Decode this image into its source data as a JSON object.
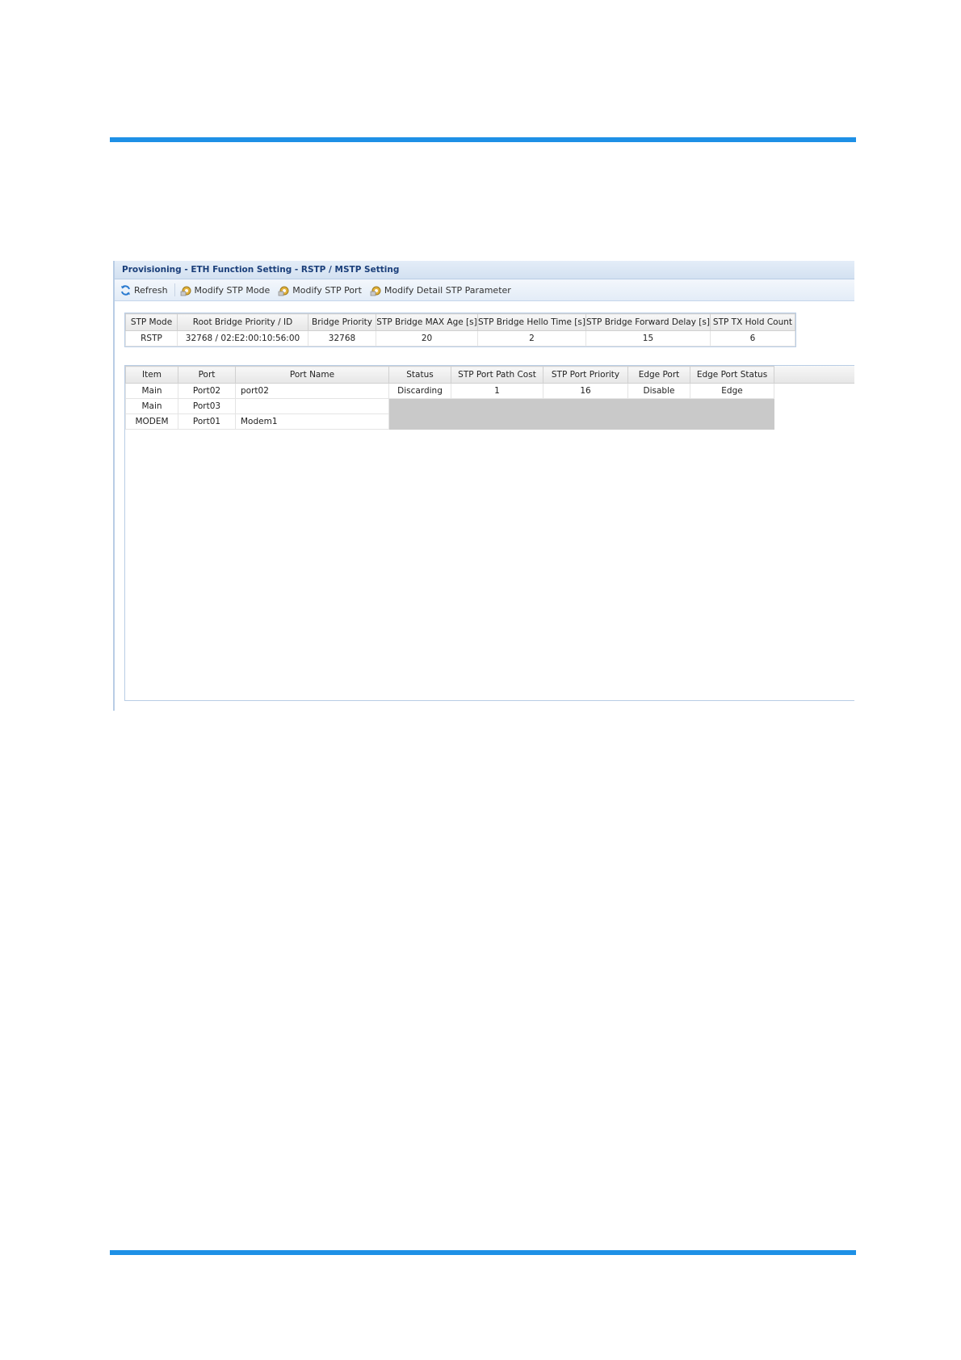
{
  "window": {
    "title": "Provisioning - ETH Function Setting - RSTP / MSTP Setting"
  },
  "toolbar": {
    "refresh_label": "Refresh",
    "modify_stp_mode_label": "Modify STP Mode",
    "modify_stp_port_label": "Modify STP Port",
    "modify_detail_label": "Modify Detail STP Parameter"
  },
  "bridge_table": {
    "headers": [
      "STP Mode",
      "Root Bridge Priority / ID",
      "Bridge Priority",
      "STP Bridge MAX Age [s]",
      "STP Bridge Hello Time [s]",
      "STP Bridge Forward Delay [s]",
      "STP TX Hold Count"
    ],
    "row": [
      "RSTP",
      "32768 / 02:E2:00:10:56:00",
      "32768",
      "20",
      "2",
      "15",
      "6"
    ]
  },
  "port_table": {
    "headers": [
      "Item",
      "Port",
      "Port Name",
      "Status",
      "STP Port Path Cost",
      "STP Port Priority",
      "Edge Port",
      "Edge Port Status"
    ],
    "rows": [
      [
        "Main",
        "Port02",
        "port02",
        "Discarding",
        "1",
        "16",
        "Disable",
        "Edge"
      ],
      [
        "Main",
        "Port03",
        "",
        "",
        "",
        "",
        "",
        ""
      ],
      [
        "MODEM",
        "Port01",
        "Modem1",
        "",
        "",
        "",
        "",
        ""
      ]
    ]
  },
  "colors": {
    "accent_rule": "#1e90e6",
    "title_text": "#1b3f7a",
    "disabled_cell": "#c9c9c9"
  }
}
